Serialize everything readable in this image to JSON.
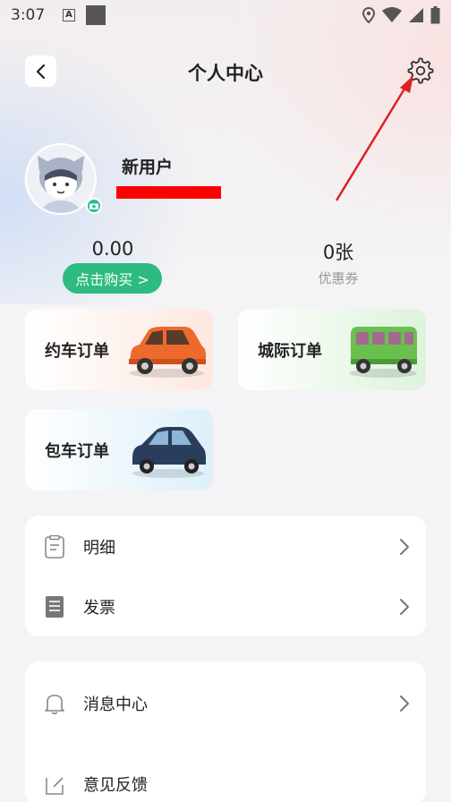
{
  "status_bar": {
    "time": "3:07",
    "a_badge": "A"
  },
  "nav": {
    "title": "个人中心",
    "back_icon": "chevron-left-icon",
    "settings_icon": "gear-icon"
  },
  "user": {
    "name": "新用户"
  },
  "stats": {
    "balance_value": "0.00",
    "buy_button_label": "点击购买 >",
    "coupon_value": "0张",
    "coupon_label": "优惠券"
  },
  "orders": [
    {
      "label": "约车订单",
      "color": "#ee6a2c"
    },
    {
      "label": "城际订单",
      "color": "#6ac04f"
    },
    {
      "label": "包车订单",
      "color": "#2a3e5c"
    }
  ],
  "menu_group_1": [
    {
      "label": "明细",
      "icon": "clipboard-icon"
    },
    {
      "label": "发票",
      "icon": "invoice-icon"
    }
  ],
  "menu_group_2": [
    {
      "label": "消息中心",
      "icon": "bell-icon"
    },
    {
      "label": "意见反馈",
      "icon": "edit-icon"
    }
  ],
  "colors": {
    "accent": "#2dbb81",
    "annotation_arrow": "#e02020"
  }
}
